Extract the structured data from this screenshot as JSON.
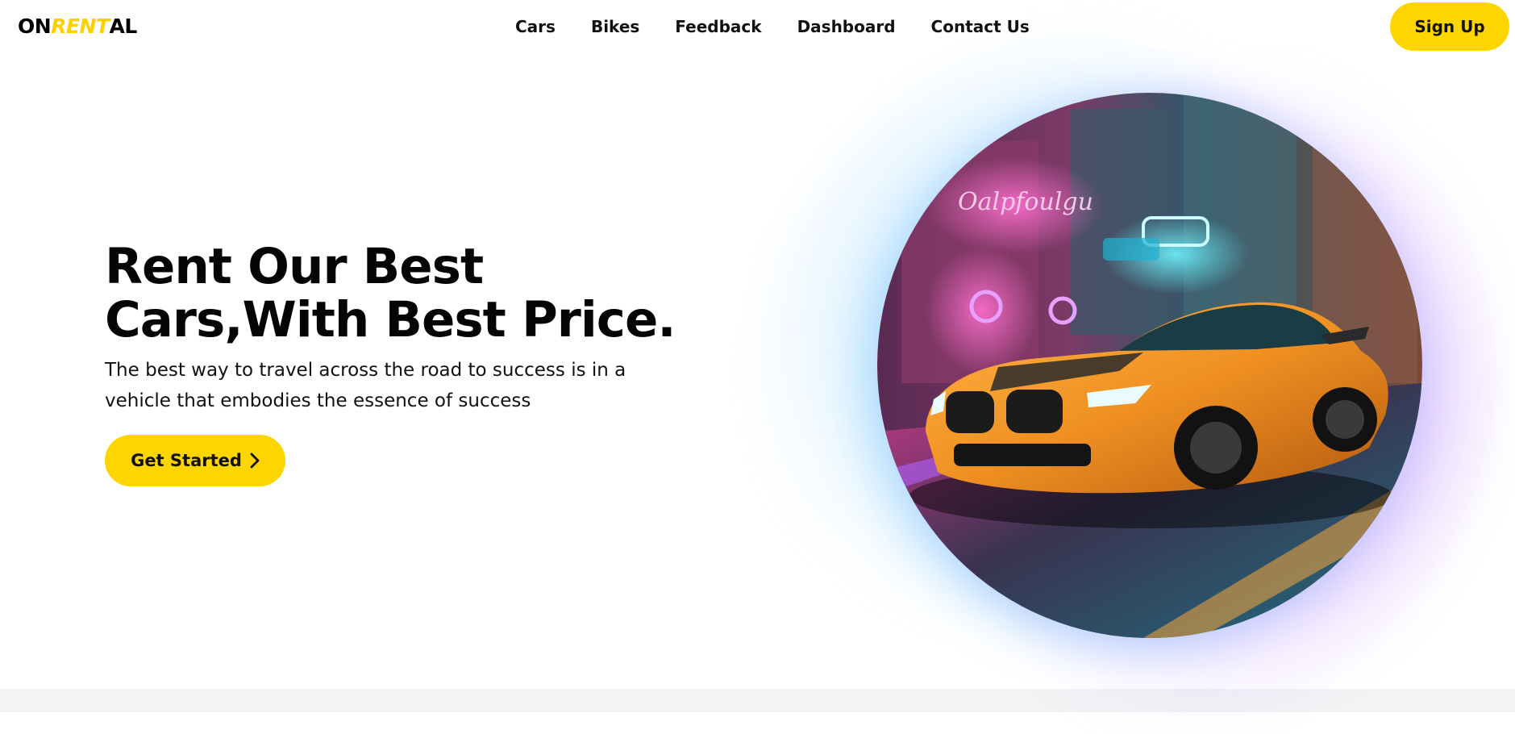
{
  "brand": {
    "part1": "ON",
    "part2": "RENT",
    "part3": "AL",
    "accent_color": "#ffd500"
  },
  "nav": {
    "items": [
      {
        "label": "Cars"
      },
      {
        "label": "Bikes"
      },
      {
        "label": "Feedback"
      },
      {
        "label": "Dashboard"
      },
      {
        "label": "Contact Us"
      }
    ],
    "signup_label": "Sign Up"
  },
  "hero": {
    "title_line1": "Rent Our Best",
    "title_line2": "Cars,With Best Price.",
    "subtitle": "The best way to travel across the road to success is in a vehicle that embodies the essence of success",
    "cta_label": "Get Started",
    "cta_icon": "chevron-right-icon",
    "image": "orange-sports-car-neon-street"
  }
}
